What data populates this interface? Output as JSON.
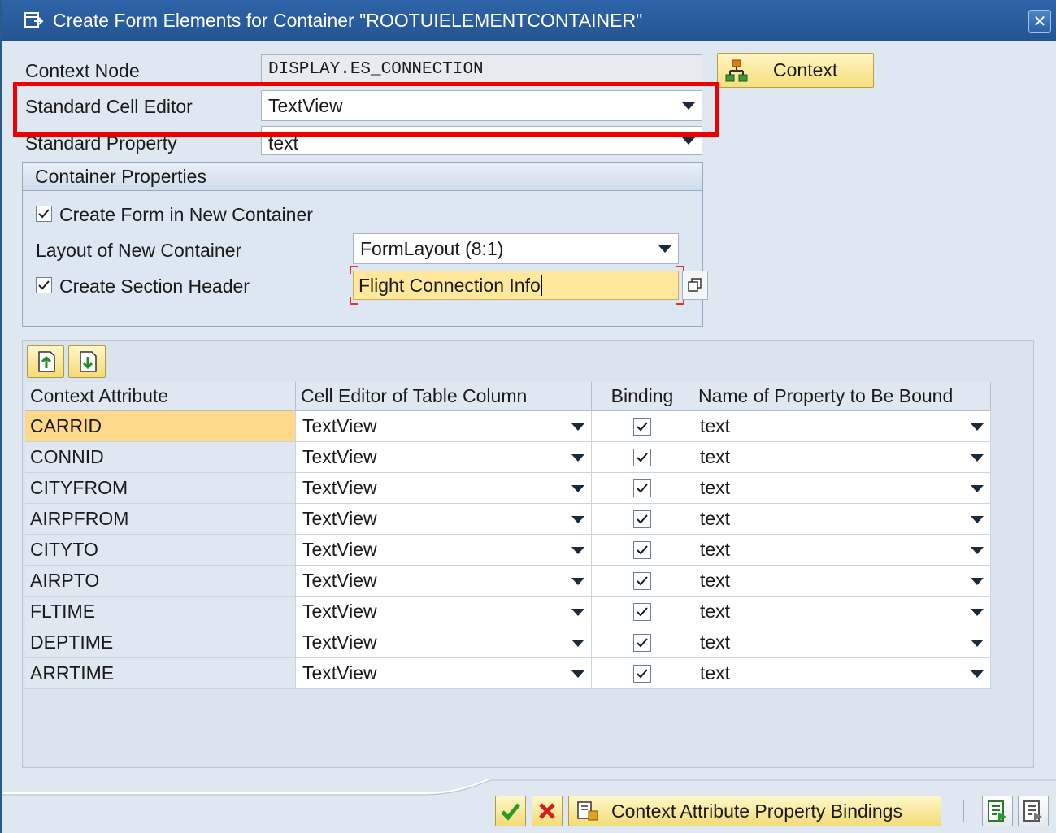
{
  "window": {
    "title": "Create Form Elements for Container \"ROOTUIELEMENTCONTAINER\""
  },
  "form": {
    "context_node_label": "Context Node",
    "context_node_value": "DISPLAY.ES_CONNECTION",
    "context_button_label": "Context",
    "standard_cell_editor_label": "Standard Cell Editor",
    "standard_cell_editor_value": "TextView",
    "standard_property_label": "Standard Property",
    "standard_property_value": "text"
  },
  "container_properties": {
    "header": "Container Properties",
    "create_form_label": "Create Form in New Container",
    "create_form_checked": true,
    "layout_label": "Layout of New Container",
    "layout_value": "FormLayout (8:1)",
    "section_header_label": "Create Section Header",
    "section_header_checked": true,
    "section_header_value": "Flight Connection Info"
  },
  "table": {
    "columns": [
      "Context Attribute",
      "Cell Editor of Table Column",
      "Binding",
      "Name of Property to Be Bound"
    ],
    "rows": [
      {
        "attribute": "CARRID",
        "editor": "TextView",
        "binding": true,
        "property": "text"
      },
      {
        "attribute": "CONNID",
        "editor": "TextView",
        "binding": true,
        "property": "text"
      },
      {
        "attribute": "CITYFROM",
        "editor": "TextView",
        "binding": true,
        "property": "text"
      },
      {
        "attribute": "AIRPFROM",
        "editor": "TextView",
        "binding": true,
        "property": "text"
      },
      {
        "attribute": "CITYTO",
        "editor": "TextView",
        "binding": true,
        "property": "text"
      },
      {
        "attribute": "AIRPTO",
        "editor": "TextView",
        "binding": true,
        "property": "text"
      },
      {
        "attribute": "FLTIME",
        "editor": "TextView",
        "binding": true,
        "property": "text"
      },
      {
        "attribute": "DEPTIME",
        "editor": "TextView",
        "binding": true,
        "property": "text"
      },
      {
        "attribute": "ARRTIME",
        "editor": "TextView",
        "binding": true,
        "property": "text"
      }
    ]
  },
  "footer": {
    "bindings_button_label": "Context Attribute Property Bindings"
  },
  "icons": {
    "confirm": "checkmark-icon",
    "cancel": "cancel-icon",
    "close": "close-icon"
  },
  "colors": {
    "title_bar": "#245592",
    "highlight": "#ee0000",
    "selected_cell": "#ffd98a",
    "input_focus": "#ffe89c"
  }
}
